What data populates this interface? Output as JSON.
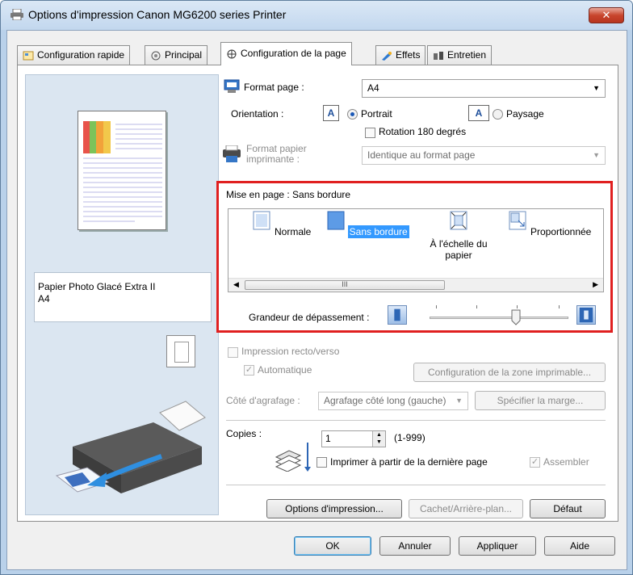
{
  "window": {
    "title": "Options d'impression Canon MG6200 series Printer",
    "close_glyph": "✕"
  },
  "tabs": [
    {
      "label": "Configuration rapide"
    },
    {
      "label": "Principal"
    },
    {
      "label": "Configuration de la page"
    },
    {
      "label": "Effets"
    },
    {
      "label": "Entretien"
    }
  ],
  "active_tab": "Configuration de la page",
  "preview": {
    "paper_name": "Papier Photo Glacé Extra II",
    "paper_size": "A4"
  },
  "page_setup": {
    "format_label": "Format page :",
    "format_value": "A4",
    "orientation_label": "Orientation :",
    "orientation_icon_glyph": "A",
    "portrait_label": "Portrait",
    "landscape_label": "Paysage",
    "orientation_selected": "Portrait",
    "rotate_label": "Rotation 180 degrés",
    "printer_paper_label_1": "Format papier",
    "printer_paper_label_2": "imprimante :",
    "printer_paper_value": "Identique au format page"
  },
  "layout": {
    "label": "Mise en page : Sans bordure",
    "items": [
      {
        "label": "Normale"
      },
      {
        "label": "Sans bordure"
      },
      {
        "label": "À l'échelle du papier"
      },
      {
        "label": "Proportionnée"
      }
    ],
    "selected": "Sans bordure",
    "scroll_grip": "III",
    "extension_label": "Grandeur de dépassement :",
    "extension_level_fraction": 0.75
  },
  "duplex": {
    "label": "Impression recto/verso",
    "auto_label": "Automatique",
    "print_area_button": "Configuration de la zone imprimable...",
    "stapling_label": "Côté d'agrafage :",
    "stapling_value": "Agrafage côté long (gauche)",
    "margin_button": "Spécifier la marge..."
  },
  "copies": {
    "label": "Copies :",
    "value": "1",
    "range": "(1-999)",
    "last_page_label": "Imprimer à partir de la dernière page",
    "collate_label": "Assembler"
  },
  "panel_buttons": {
    "print_options": "Options d'impression...",
    "stamp_background": "Cachet/Arrière-plan...",
    "defaults": "Défaut"
  },
  "dialog_buttons": {
    "ok": "OK",
    "cancel": "Annuler",
    "apply": "Appliquer",
    "help": "Aide"
  },
  "colors": {
    "highlight_frame": "#e02020",
    "selection": "#3399ff",
    "title_bg": "#c2d7ee"
  }
}
